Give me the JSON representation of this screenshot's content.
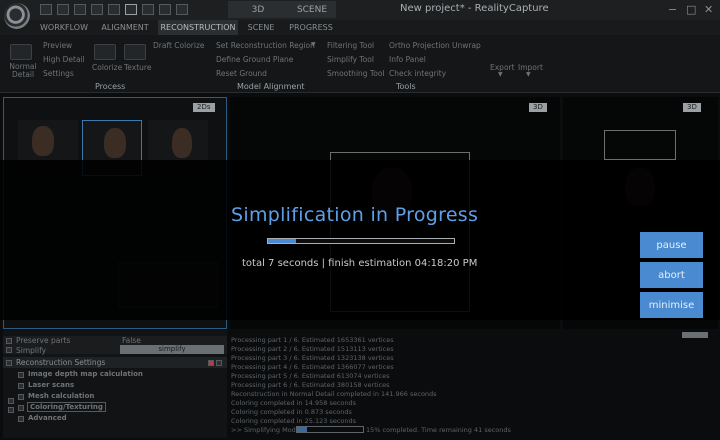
{
  "window": {
    "title": "New project* - RealityCapture",
    "modes": [
      "3D",
      "SCENE"
    ],
    "controls": [
      "−",
      "□",
      "✕"
    ]
  },
  "menu": {
    "tabs": [
      "WORKFLOW",
      "ALIGNMENT",
      "RECONSTRUCTION",
      "SCENE",
      "PROGRESS"
    ],
    "active": "RECONSTRUCTION"
  },
  "ribbon": {
    "process": {
      "label": "Process",
      "normal_detail": "Normal Detail",
      "preview": "Preview",
      "high_detail": "High Detail",
      "settings": "Settings",
      "colorize": "Colorize",
      "texture": "Texture",
      "draft_colorize": "Draft Colorize"
    },
    "model_alignment": {
      "label": "Model Alignment",
      "set_region": "Set Reconstruction Region",
      "define_ground": "Define Ground Plane",
      "reset_ground": "Reset Ground"
    },
    "tools": {
      "label": "Tools",
      "filtering": "Filtering Tool",
      "simplify": "Simplify Tool",
      "smoothing": "Smoothing Tool",
      "ortho": "Ortho Projection",
      "unwrap": "Unwrap",
      "info": "Info Panel",
      "check": "Check integrity",
      "export": "Export",
      "import": "Import"
    }
  },
  "panes": {
    "left_tag": "2Ds",
    "center_tag": "3D",
    "right_tag": "3D"
  },
  "settings": {
    "preserve_parts": "Preserve parts",
    "preserve_parts_value": "False",
    "simplify": "Simplify",
    "simplify_button": "simplify",
    "header": "Reconstruction Settings",
    "items": [
      "Image depth map calculation",
      "Laser scans",
      "Mesh calculation",
      "Coloring/Texturing",
      "Advanced"
    ]
  },
  "log": {
    "lines": [
      "Processing part 1 / 6. Estimated 1653361 vertices",
      "Processing part 2 / 6. Estimated 1513113 vertices",
      "Processing part 3 / 6. Estimated 1323138 vertices",
      "Processing part 4 / 6. Estimated 1366077 vertices",
      "Processing part 5 / 6. Estimated 613074 vertices",
      "Processing part 6 / 6. Estimated 380158 vertices",
      "Reconstruction in Normal Detail completed in 141.966 seconds",
      "Coloring completed in 14.958 seconds",
      "Coloring completed in 0.873 seconds",
      "Coloring completed in 25.123 seconds"
    ],
    "status_prefix": ">> Simplifying Model",
    "status_suffix": "15% completed. Time remaining 41 seconds",
    "status_progress": 0.15
  },
  "overlay": {
    "title": "Simplification in Progress",
    "progress": 0.15,
    "status": "total 7 seconds | finish estimation 04:18:20 PM",
    "buttons": [
      "pause",
      "abort",
      "minimise"
    ]
  }
}
